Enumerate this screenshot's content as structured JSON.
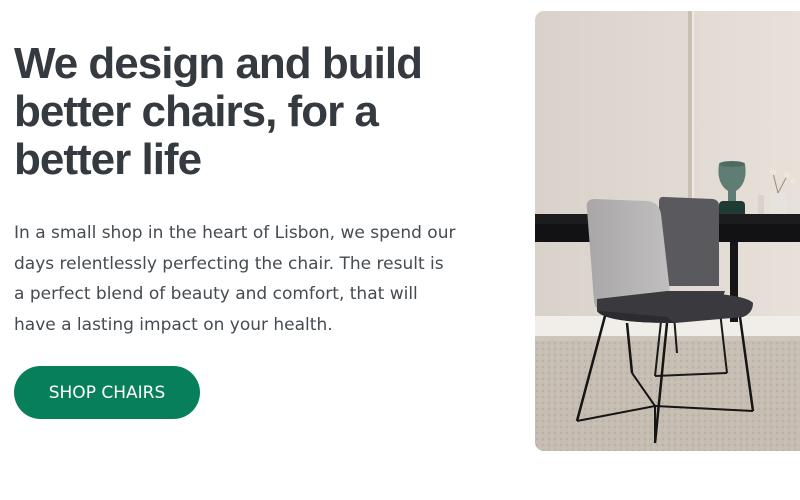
{
  "hero": {
    "headline": "We design and build\nbetter chairs, for a\nbetter life",
    "description": "In a small shop in the heart of Lisbon, we spend our\ndays relentlessly perfecting the chair. The result is\na perfect blend of beauty and comfort, that will\nhave a lasting impact on your health.",
    "cta_label": "SHOP CHAIRS"
  },
  "image": {
    "alt": "Grey upholstered chairs at a dark dining table"
  },
  "colors": {
    "accent": "#087f5b",
    "heading": "#343a40",
    "body": "#454b51"
  }
}
